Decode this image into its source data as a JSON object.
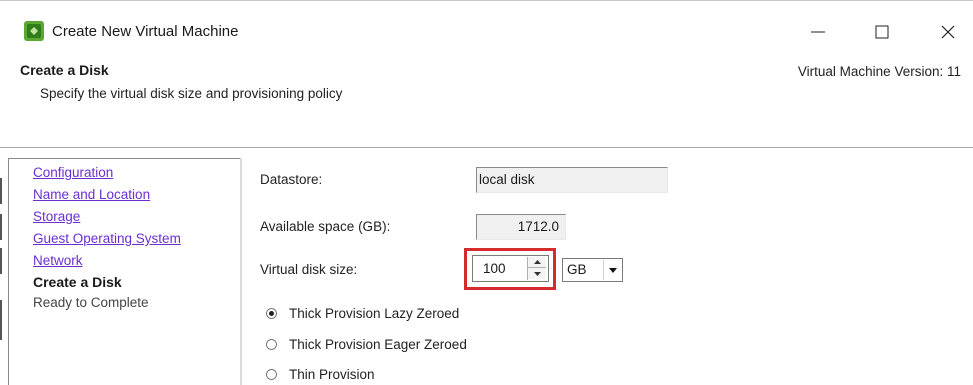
{
  "window": {
    "title": "Create New Virtual Machine",
    "minimize": "—",
    "maximize": "☐",
    "close": "✕"
  },
  "header": {
    "title": "Create a Disk",
    "subtitle": "Specify the virtual disk size and provisioning policy",
    "version": "Virtual Machine Version: 11"
  },
  "nav": {
    "items": [
      {
        "label": "Configuration"
      },
      {
        "label": "Name and Location"
      },
      {
        "label": "Storage"
      },
      {
        "label": "Guest Operating System"
      },
      {
        "label": "Network"
      },
      {
        "label": "Create a Disk"
      },
      {
        "label": "Ready to Complete"
      }
    ]
  },
  "form": {
    "datastore_label": "Datastore:",
    "datastore_value": "local disk",
    "available_label": "Available space (GB):",
    "available_value": "1712.0",
    "disk_size_label": "Virtual disk size:",
    "disk_size_value": "100",
    "disk_unit": "GB",
    "provisioning": [
      {
        "label": "Thick Provision Lazy Zeroed",
        "selected": true
      },
      {
        "label": "Thick Provision Eager Zeroed",
        "selected": false
      },
      {
        "label": "Thin Provision",
        "selected": false
      }
    ]
  },
  "colors": {
    "link": "#6b2fd0",
    "highlight": "#d42c2c"
  }
}
